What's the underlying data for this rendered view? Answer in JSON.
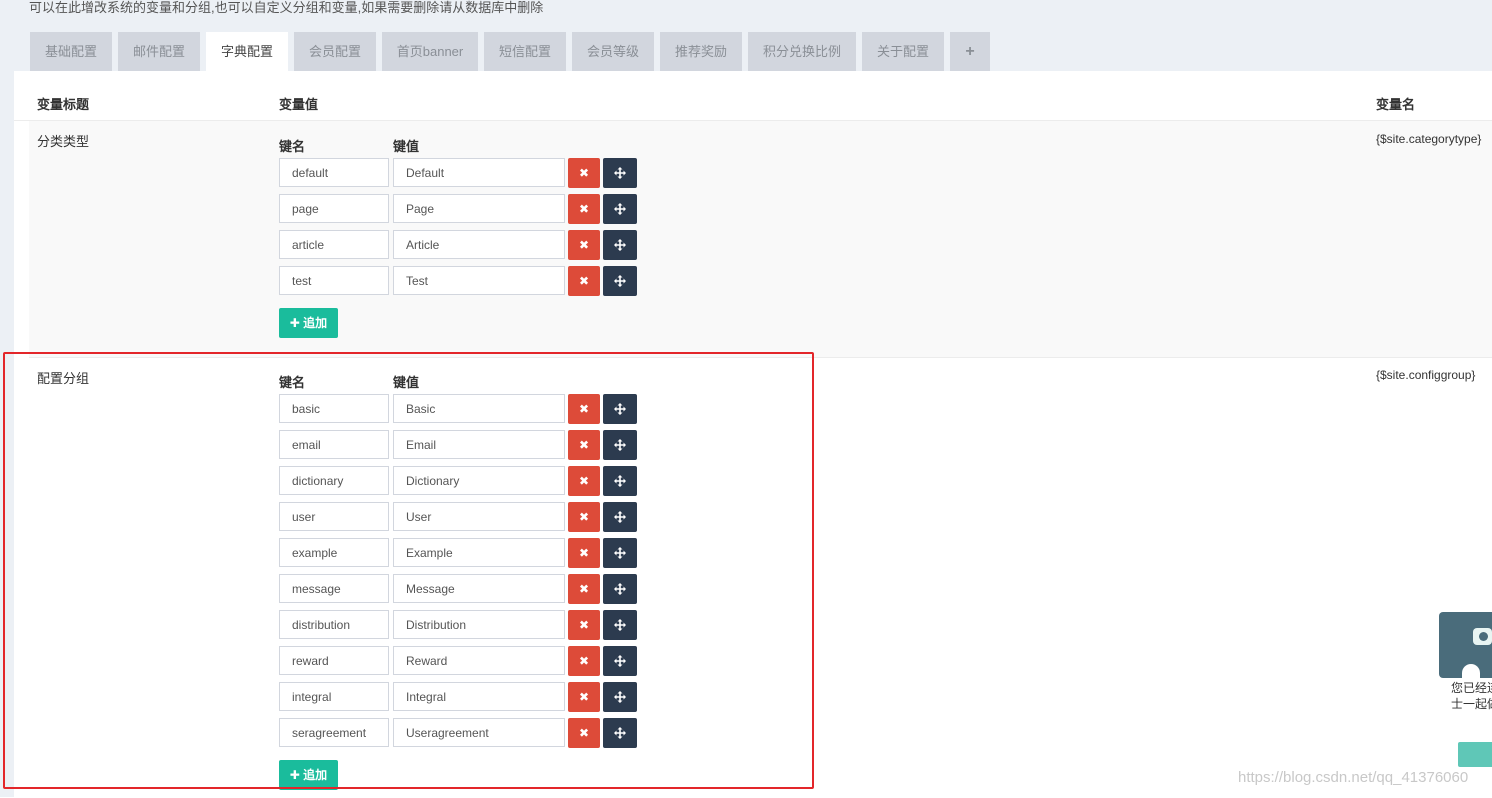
{
  "notice": "可以在此增改系统的变量和分组,也可以自定义分组和变量,如果需要删除请从数据库中删除",
  "tabs": [
    {
      "label": "基础配置"
    },
    {
      "label": "邮件配置"
    },
    {
      "label": "字典配置"
    },
    {
      "label": "会员配置"
    },
    {
      "label": "首页banner"
    },
    {
      "label": "短信配置"
    },
    {
      "label": "会员等级"
    },
    {
      "label": "推荐奖励"
    },
    {
      "label": "积分兑换比例"
    },
    {
      "label": "关于配置"
    },
    {
      "label": "+"
    }
  ],
  "table_headers": {
    "title": "变量标题",
    "value": "变量值",
    "name": "变量名"
  },
  "kv_headers": {
    "key": "键名",
    "value": "键值"
  },
  "del_icon": "✖",
  "add_label": "✚ 追加",
  "groups": [
    {
      "title": "分类类型",
      "var_name": "{$site.categorytype}",
      "rows": [
        {
          "key": "default",
          "value": "Default"
        },
        {
          "key": "page",
          "value": "Page"
        },
        {
          "key": "article",
          "value": "Article"
        },
        {
          "key": "test",
          "value": "Test"
        }
      ]
    },
    {
      "title": "配置分组",
      "var_name": "{$site.configgroup}",
      "rows": [
        {
          "key": "basic",
          "value": "Basic"
        },
        {
          "key": "email",
          "value": "Email"
        },
        {
          "key": "dictionary",
          "value": "Dictionary"
        },
        {
          "key": "user",
          "value": "User"
        },
        {
          "key": "example",
          "value": "Example"
        },
        {
          "key": "message",
          "value": "Message"
        },
        {
          "key": "distribution",
          "value": "Distribution"
        },
        {
          "key": "reward",
          "value": "Reward"
        },
        {
          "key": "integral",
          "value": "Integral"
        },
        {
          "key": "seragreement",
          "value": "Useragreement"
        }
      ]
    }
  ],
  "float_widget": {
    "line1": "您已经连",
    "line2": "士一起做"
  },
  "watermark": "https://blog.csdn.net/qq_41376060"
}
